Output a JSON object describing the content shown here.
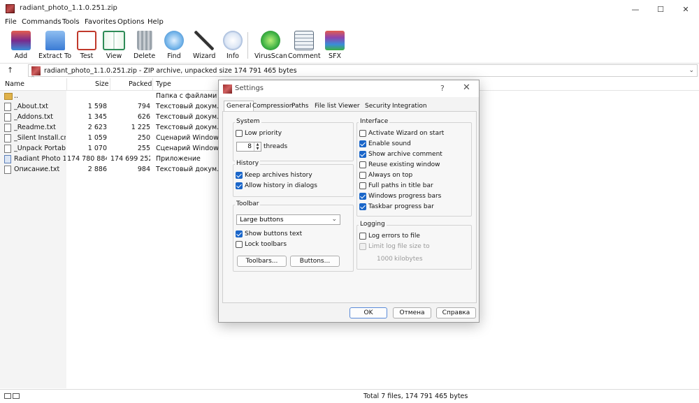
{
  "window": {
    "title": "radiant_photo_1.1.0.251.zip",
    "minimize": "—",
    "maximize": "☐",
    "close": "✕"
  },
  "menu": [
    "File",
    "Commands",
    "Tools",
    "Favorites",
    "Options",
    "Help"
  ],
  "toolbar": [
    {
      "label": "Add",
      "icon": "add-archive-icon",
      "color": "#d9534f"
    },
    {
      "label": "Extract To",
      "icon": "extract-folder-icon",
      "color": "#3a7bd5"
    },
    {
      "label": "Test",
      "icon": "test-checklist-icon",
      "color": "#c0392b"
    },
    {
      "label": "View",
      "icon": "view-book-icon",
      "color": "#2e8b57"
    },
    {
      "label": "Delete",
      "icon": "trash-icon",
      "color": "#7f8c8d"
    },
    {
      "label": "Find",
      "icon": "magnifier-icon",
      "color": "#2980b9"
    },
    {
      "label": "Wizard",
      "icon": "wand-icon",
      "color": "#27ae60"
    },
    {
      "label": "Info",
      "icon": "info-icon",
      "color": "#2c5aa0"
    },
    {
      "label": "VirusScan",
      "icon": "virus-scan-icon",
      "color": "#3cb043"
    },
    {
      "label": "Comment",
      "icon": "comment-icon",
      "color": "#5d6d7e"
    },
    {
      "label": "SFX",
      "icon": "sfx-books-icon",
      "color": "#8e44ad"
    }
  ],
  "address": {
    "up": "↑",
    "text": "radiant_photo_1.1.0.251.zip - ZIP archive, unpacked size 174 791 465 bytes",
    "dropdown": "⌄"
  },
  "columns": {
    "name": "Name",
    "size": "Size",
    "packed": "Packed",
    "type": "Type",
    "sort_caret": "^"
  },
  "files": [
    {
      "name": "..",
      "size": "",
      "packed": "",
      "type": "Папка с файлами",
      "kind": "folder"
    },
    {
      "name": "_About.txt",
      "size": "1 598",
      "packed": "794",
      "type": "Текстовый докум...",
      "kind": "doc"
    },
    {
      "name": "_Addons.txt",
      "size": "1 345",
      "packed": "626",
      "type": "Текстовый докум...",
      "kind": "doc"
    },
    {
      "name": "_Readme.txt",
      "size": "2 623",
      "packed": "1 225",
      "type": "Текстовый докум...",
      "kind": "doc"
    },
    {
      "name": "_Silent Install.cmd",
      "size": "1 059",
      "packed": "250",
      "type": "Сценарий Windows",
      "kind": "doc"
    },
    {
      "name": "_Unpack Portabl...",
      "size": "1 070",
      "packed": "255",
      "type": "Сценарий Windows",
      "kind": "doc"
    },
    {
      "name": "Radiant Photo 1....",
      "size": "174 780 884",
      "packed": "174 699 252",
      "type": "Приложение",
      "kind": "app"
    },
    {
      "name": "Описание.txt",
      "size": "2 886",
      "packed": "984",
      "type": "Текстовый докум...",
      "kind": "doc"
    }
  ],
  "status": {
    "text": "Total 7 files, 174 791 465 bytes"
  },
  "dialog": {
    "title": "Settings",
    "help": "?",
    "close": "✕",
    "tabs": [
      "General",
      "Compression",
      "Paths",
      "File list",
      "Viewer",
      "Security",
      "Integration"
    ],
    "system": {
      "title": "System",
      "low_priority": "Low priority",
      "threads_value": "8",
      "threads_label": "threads"
    },
    "history": {
      "title": "History",
      "keep": "Keep archives history",
      "allow": "Allow history in dialogs"
    },
    "toolbar_group": {
      "title": "Toolbar",
      "select_value": "Large buttons",
      "show_text": "Show buttons text",
      "lock": "Lock toolbars",
      "toolbars_btn": "Toolbars...",
      "buttons_btn": "Buttons..."
    },
    "interface": {
      "title": "Interface",
      "items": [
        {
          "label": "Activate Wizard on start",
          "checked": false
        },
        {
          "label": "Enable sound",
          "checked": true
        },
        {
          "label": "Show archive comment",
          "checked": true
        },
        {
          "label": "Reuse existing window",
          "checked": false
        },
        {
          "label": "Always on top",
          "checked": false
        },
        {
          "label": "Full paths in title bar",
          "checked": false
        },
        {
          "label": "Windows progress bars",
          "checked": true
        },
        {
          "label": "Taskbar progress bar",
          "checked": true
        }
      ]
    },
    "logging": {
      "title": "Logging",
      "log_errors": "Log errors to file",
      "limit": "Limit log file size to",
      "size_value": "1000",
      "size_unit": "kilobytes"
    },
    "buttons": {
      "ok": "OK",
      "cancel": "Отмена",
      "help": "Справка"
    }
  }
}
